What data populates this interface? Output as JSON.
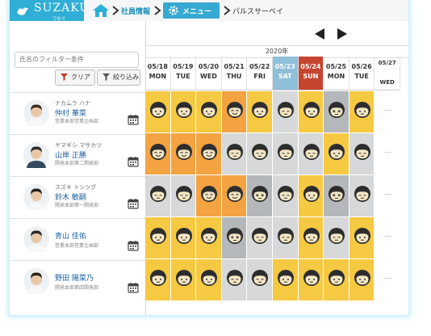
{
  "app": {
    "brand": "SUZAKU",
    "brand_sub": "つなぐ"
  },
  "breadcrumb": {
    "item1": "社員情報",
    "menu_label": "メニュー",
    "item3": "パルスサーベイ"
  },
  "filter": {
    "placeholder": "氏名のフィルター条件",
    "clear_label": "クリア",
    "apply_label": "絞り込み"
  },
  "year_label": "2020年",
  "dates": [
    {
      "date": "05/18",
      "dow": "MON",
      "type": "weekday"
    },
    {
      "date": "05/19",
      "dow": "TUE",
      "type": "weekday"
    },
    {
      "date": "05/20",
      "dow": "WED",
      "type": "weekday"
    },
    {
      "date": "05/21",
      "dow": "THU",
      "type": "weekday"
    },
    {
      "date": "05/22",
      "dow": "FRI",
      "type": "weekday"
    },
    {
      "date": "05/23",
      "dow": "SAT",
      "type": "sat"
    },
    {
      "date": "05/24",
      "dow": "SUN",
      "type": "sun"
    },
    {
      "date": "05/25",
      "dow": "MON",
      "type": "weekday"
    },
    {
      "date": "05/26",
      "dow": "TUE",
      "type": "weekday"
    },
    {
      "date": "05/27",
      "dow": "WED",
      "type": "weekday"
    }
  ],
  "people": [
    {
      "kana": "ナカムラ ハナ",
      "name": "仲村 華菜",
      "dept": "営業本部営業企画部",
      "gender": "f",
      "moods": [
        "neutral",
        "neutral",
        "neutral",
        "happy",
        "neutral",
        "sad",
        "neutral",
        "xeyes",
        "neutral"
      ],
      "empty": "---"
    },
    {
      "kana": "ヤマギシ マサカツ",
      "name": "山岸 正勝",
      "dept": "開発本部第二開発部",
      "gender": "m",
      "moods": [
        "happy",
        "happy",
        "happy",
        "sad",
        "sad",
        "sad",
        "sad",
        "neutral",
        "sad"
      ],
      "empty": "---"
    },
    {
      "kana": "スズキ トシツグ",
      "name": "鈴木 敏嗣",
      "dept": "開発本部第一開発部",
      "gender": "f2",
      "moods": [
        "sad",
        "sad",
        "happy",
        "happy",
        "xeyes",
        "sad",
        "neutral",
        "xeyes",
        "sad"
      ],
      "empty": "---"
    },
    {
      "kana": "",
      "name": "青山 佳佑",
      "dept": "営業本部営業企画部",
      "gender": "f3",
      "moods": [
        "neutral",
        "neutral",
        "neutral",
        "xeyes",
        "sad",
        "sad",
        "neutral",
        "sad",
        "neutral"
      ],
      "empty": "---"
    },
    {
      "kana": "",
      "name": "野田 陽菜乃",
      "dept": "開発本部第四開発部",
      "gender": "f4",
      "moods": [
        "neutral",
        "neutral",
        "neutral",
        "sad",
        "sad",
        "neutral",
        "neutral",
        "neutral",
        "neutral"
      ],
      "empty": "---"
    }
  ],
  "colors": {
    "header": "#2faed6",
    "happy_orange": "#f3a341",
    "neutral_yellow": "#f6c943",
    "sad_gray": "#d7d8d9",
    "xeyes_gray": "#b5b8ba",
    "pale_yellow": "#f6ee9a",
    "sat_bg": "#8fbfd9",
    "sun_bg": "#c6452e"
  }
}
